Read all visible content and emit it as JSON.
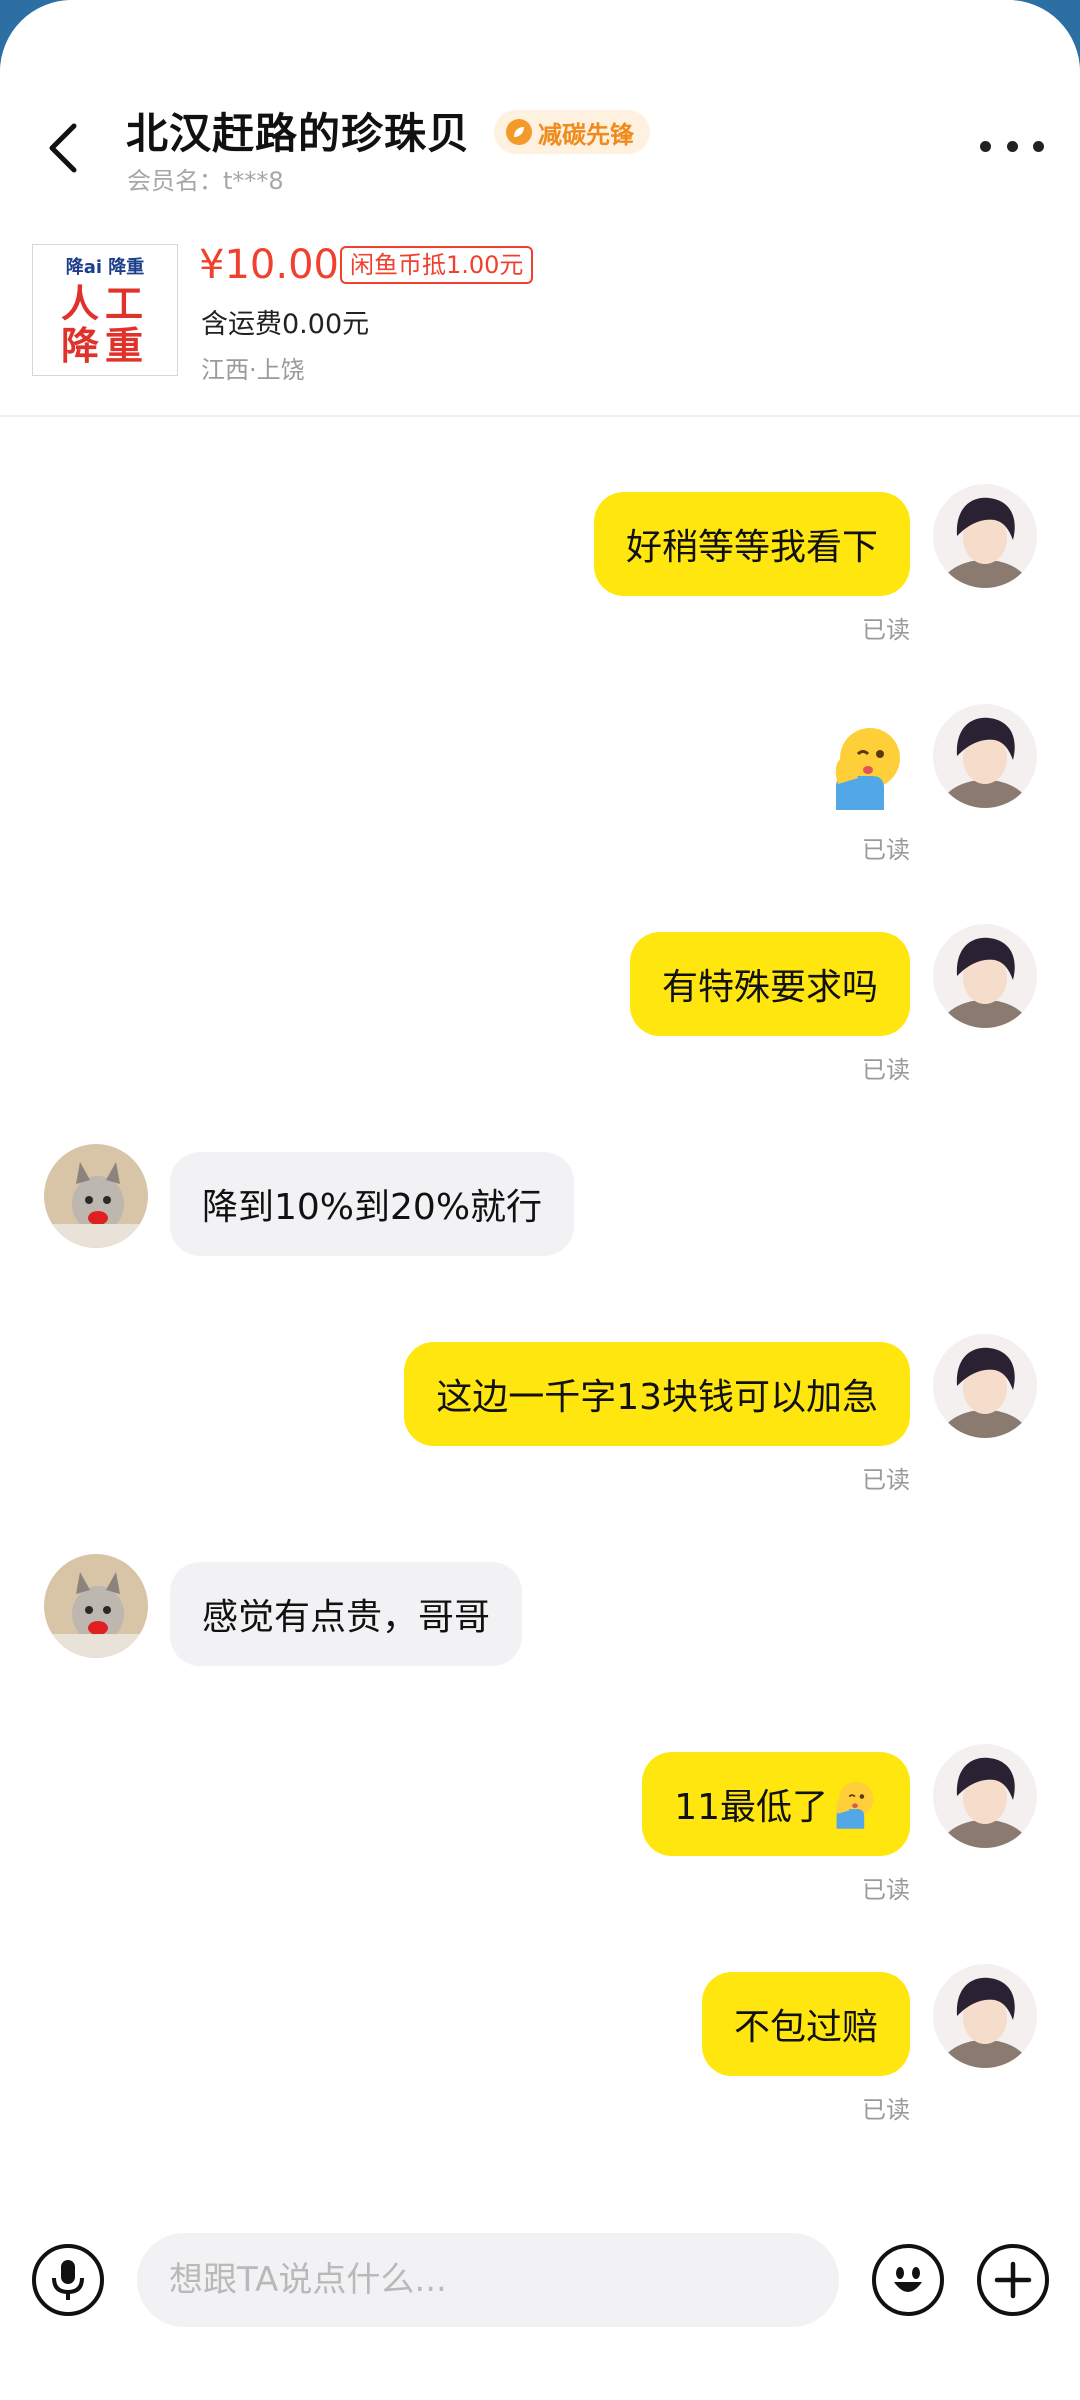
{
  "header": {
    "title": "北汉赶路的珍珠贝",
    "badge_label": "减碳先锋",
    "member_label": "会员名：t***8",
    "back_icon": "chevron-left-icon",
    "more_icon": "more-dots-icon"
  },
  "product": {
    "thumb_top_text": "降ai 降重",
    "thumb_big_text": "人工降重",
    "price": "¥10.00",
    "coin_discount": "闲鱼币抵1.00元",
    "shipping": "含运费0.00元",
    "location": "江西·上饶"
  },
  "colors": {
    "my_bubble": "#ffe60f",
    "their_bubble": "#f2f2f4",
    "price_red": "#f0402e",
    "badge_orange": "#f08a1b"
  },
  "messages": [
    {
      "from": "me",
      "type": "text",
      "text": "好稍等等我看下",
      "status": "已读"
    },
    {
      "from": "me",
      "type": "emoji",
      "emoji": "shushing-face-emoji",
      "status": "已读"
    },
    {
      "from": "me",
      "type": "text",
      "text": "有特殊要求吗",
      "status": "已读"
    },
    {
      "from": "them",
      "type": "text",
      "text": "降到10%到20%就行"
    },
    {
      "from": "me",
      "type": "text",
      "text": "这边一千字13块钱可以加急",
      "status": "已读"
    },
    {
      "from": "them",
      "type": "text",
      "text": "感觉有点贵，哥哥"
    },
    {
      "from": "me",
      "type": "text",
      "text": "11最低了",
      "trailing_emoji": "shushing-face-emoji",
      "status": "已读"
    },
    {
      "from": "me",
      "type": "text",
      "text": "不包过赔",
      "status": "已读"
    }
  ],
  "input_bar": {
    "placeholder": "想跟TA说点什么...",
    "voice_icon": "microphone-icon",
    "emoji_icon": "smiley-icon",
    "plus_icon": "plus-icon"
  }
}
